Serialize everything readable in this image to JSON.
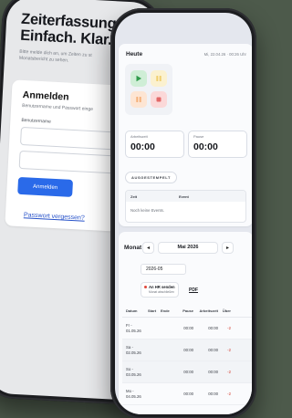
{
  "login": {
    "hero_title": "Zeiterfassung.\nEinfach. Klar. Sch",
    "hero_sub": "Bitte melde dich an, um Zeiten zu st Monatsbericht zu sehen.",
    "card_title": "Anmelden",
    "card_sub": "Benutzername und Passwort einge",
    "username_label": "Benutzername",
    "username_value": "",
    "password_value": "",
    "login_button": "Anmelden",
    "forgot_link": "Passwort vergessen?"
  },
  "today": {
    "title": "Heute",
    "date": "Mi, 22.04.26 · 00:26 Uhr",
    "controls": [
      "play-icon",
      "pause-icon",
      "break-icon",
      "stop-icon"
    ],
    "work_label": "Arbeitszeit",
    "work_value": "00:00",
    "pause_label": "Pause",
    "pause_value": "00:00",
    "status_badge": "AUSGESTEMPELT",
    "events_columns": [
      "Zeit",
      "Event"
    ],
    "events_empty": "Noch keine Events."
  },
  "month": {
    "title": "Monat",
    "prev": "◂",
    "next": "▸",
    "label": "Mai 2026",
    "input_value": "2026-05",
    "hr_title": "An HR senden",
    "hr_sub": "Monat abschließen",
    "pdf": "PDF",
    "columns": [
      "Datum",
      "Start",
      "Ende",
      "Pause",
      "Arbeitszeit",
      "Über"
    ],
    "rows": [
      {
        "date": "Fr - 01.05.26",
        "start": "",
        "end": "",
        "pause": "00:00",
        "work": "00:00",
        "over": "-2"
      },
      {
        "date": "Sa - 02.05.26",
        "start": "",
        "end": "",
        "pause": "00:00",
        "work": "00:00",
        "over": "-2"
      },
      {
        "date": "So - 03.05.26",
        "start": "",
        "end": "",
        "pause": "00:00",
        "work": "00:00",
        "over": "-2"
      },
      {
        "date": "Mo - 04.05.26",
        "start": "",
        "end": "",
        "pause": "00:00",
        "work": "00:00",
        "over": "-2"
      }
    ]
  },
  "colors": {
    "background": "#4d5a4b",
    "accent": "#2a6ae9",
    "play": "#2f9a4b",
    "pause": "#e2b43a",
    "break": "#ee9a57",
    "stop": "#e05656",
    "negative": "#d33a2c"
  }
}
